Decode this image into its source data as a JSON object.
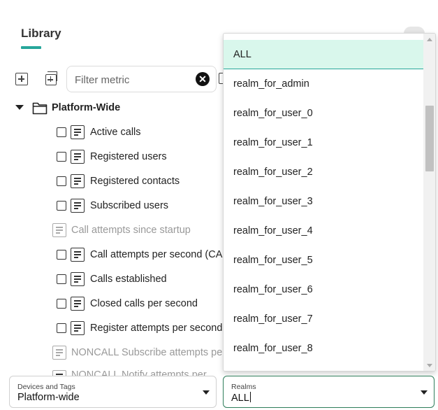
{
  "library": {
    "title": "Library"
  },
  "filter": {
    "placeholder": "Filter metric",
    "clear_glyph": "✕"
  },
  "tree": {
    "root_label": "Platform-Wide",
    "metrics": [
      {
        "label": "Active calls",
        "enabled": true
      },
      {
        "label": "Registered users",
        "enabled": true
      },
      {
        "label": "Registered contacts",
        "enabled": true
      },
      {
        "label": "Subscribed users",
        "enabled": true
      },
      {
        "label": "Call attempts since startup",
        "enabled": false
      },
      {
        "label": "Call attempts per second (CAPS)",
        "enabled": true
      },
      {
        "label": "Calls established",
        "enabled": true
      },
      {
        "label": "Closed calls per second",
        "enabled": true
      },
      {
        "label": "Register attempts per second",
        "enabled": true
      },
      {
        "label": "NONCALL Subscribe attempts per second",
        "enabled": false
      },
      {
        "label": "NONCALL Notify attempts per second",
        "enabled": false
      }
    ]
  },
  "realm_dropdown": {
    "selected": "ALL",
    "options": [
      "ALL",
      "realm_for_admin",
      "realm_for_user_0",
      "realm_for_user_1",
      "realm_for_user_2",
      "realm_for_user_3",
      "realm_for_user_4",
      "realm_for_user_5",
      "realm_for_user_6",
      "realm_for_user_7",
      "realm_for_user_8"
    ]
  },
  "devices_select": {
    "caption": "Devices and Tags",
    "value": "Platform-wide"
  },
  "realms_select": {
    "caption": "Realms",
    "value": "ALL"
  },
  "colors": {
    "accent": "#26a69a",
    "selected_bg": "#d9f7ec",
    "focus_border": "#2e7d5b",
    "disabled_text": "#999999"
  }
}
